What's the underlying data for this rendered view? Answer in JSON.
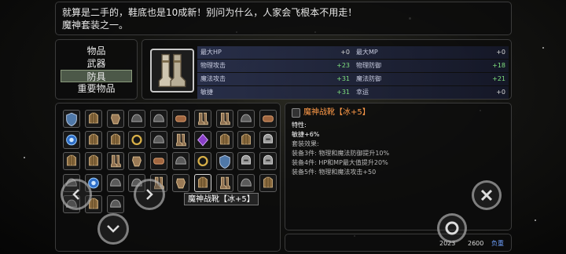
{
  "description": {
    "line1": "就算是二手的，鞋底也是10成新！别问为什么，人家会飞根本不用走！",
    "line2": "魔神套装之一。"
  },
  "categories": [
    {
      "label": "物品",
      "active": false
    },
    {
      "label": "武器",
      "active": false
    },
    {
      "label": "防具",
      "active": true
    },
    {
      "label": "重要物品",
      "active": false
    }
  ],
  "stats": [
    [
      {
        "label": "最大HP",
        "value": "+0"
      },
      {
        "label": "最大MP",
        "value": "+0"
      }
    ],
    [
      {
        "label": "物理攻击",
        "value": "+23"
      },
      {
        "label": "物理防御",
        "value": "+18"
      }
    ],
    [
      {
        "label": "魔法攻击",
        "value": "+31"
      },
      {
        "label": "魔法防御",
        "value": "+21"
      }
    ],
    [
      {
        "label": "敏捷",
        "value": "+31"
      },
      {
        "label": "幸运",
        "value": "+0"
      }
    ]
  ],
  "tooltip": "魔神战靴【冰+5】",
  "detail": {
    "name": "魔神战靴【冰+5】",
    "traits_label": "特性:",
    "trait": "敏捷+6%",
    "set_label": "套装效果:",
    "set_effects": [
      "装备3件: 物理和魔法防御提升10%",
      "装备4件: HP和MP最大值提升20%",
      "装备5件: 物理和魔法攻击+50"
    ]
  },
  "status": {
    "money": "2023",
    "weight": "2600",
    "weight_label": "负重"
  },
  "inventory": {
    "items": [
      "shield-icon",
      "armor-icon",
      "gauntlet-icon",
      "hat-icon",
      "hat-icon",
      "bracer-icon",
      "boots-icon",
      "boots-icon",
      "hat-icon",
      "bracer-icon",
      "orb-icon",
      "armor-icon",
      "armor-icon",
      "ring-icon",
      "hat-icon",
      "boots-icon",
      "gem-icon",
      "armor-icon",
      "armor-icon",
      "helmet-icon",
      "armor-icon",
      "armor-icon",
      "boots-icon",
      "gauntlet-icon",
      "bracer-icon",
      "hat-icon",
      "ring-icon",
      "shield-icon",
      "helmet-icon",
      "helmet-icon",
      "hat-icon",
      "orb-icon",
      "hat-icon",
      "hat-icon",
      "boots-icon",
      "gauntlet-icon",
      "armor-icon",
      "boots-icon",
      "hat-icon",
      "armor-icon",
      "hat-icon",
      "armor-icon",
      "hat-icon"
    ],
    "selected_index": 36
  },
  "colors": {
    "accent_orange": "#ff9a48",
    "stat_green": "#7fe07f",
    "category_active": "#4c5848"
  }
}
